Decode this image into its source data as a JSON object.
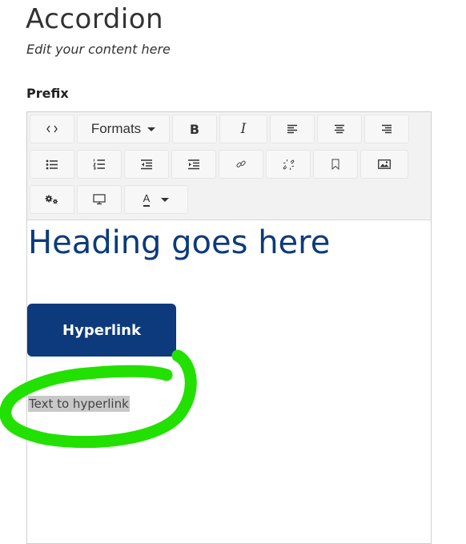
{
  "page": {
    "title": "Accordion",
    "subtitle": "Edit your content here"
  },
  "field": {
    "label": "Prefix"
  },
  "toolbar": {
    "formats_label": "Formats",
    "bold_label": "B",
    "italic_label": "I",
    "font_color_label": "A",
    "icons": [
      "source-code-icon",
      "formats-dropdown",
      "bold-icon",
      "italic-icon",
      "align-left-icon",
      "align-center-icon",
      "align-right-icon",
      "bullet-list-icon",
      "numbered-list-icon",
      "outdent-icon",
      "indent-icon",
      "link-icon",
      "unlink-icon",
      "bookmark-icon",
      "image-icon",
      "settings-icon",
      "preview-icon",
      "font-color-icon"
    ]
  },
  "content": {
    "heading": "Heading goes here",
    "button_label": "Hyperlink",
    "link_text": "Text to hyperlink"
  },
  "colors": {
    "heading": "#0d3a7c",
    "button_bg": "#0d3a7c",
    "annotation": "#22e000",
    "text_highlight": "#c8c8c8"
  }
}
